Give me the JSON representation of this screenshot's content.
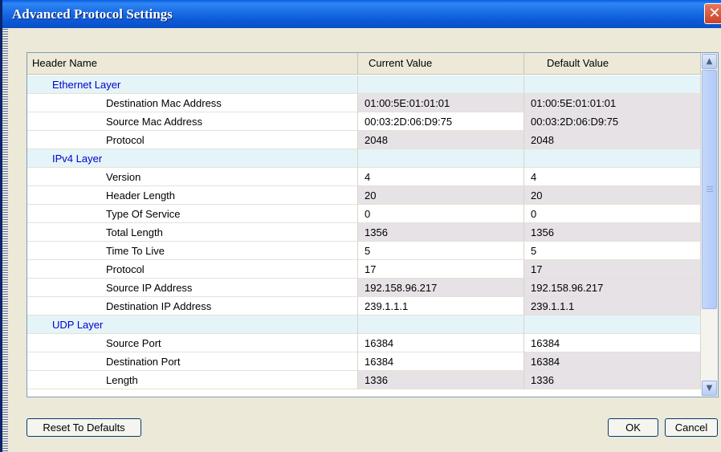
{
  "window": {
    "title": "Advanced Protocol Settings",
    "close_glyph": "✕"
  },
  "grid": {
    "columns": [
      "Header Name",
      "Current Value",
      "Default Value"
    ],
    "rows": [
      {
        "type": "group",
        "name": "Ethernet Layer"
      },
      {
        "type": "field",
        "name": "Destination Mac Address",
        "current": "01:00:5E:01:01:01",
        "default": "01:00:5E:01:01:01"
      },
      {
        "type": "field",
        "name": "Source Mac Address",
        "current": "00:03:2D:06:D9:75",
        "default": "00:03:2D:06:D9:75"
      },
      {
        "type": "field",
        "name": "Protocol",
        "current": "2048",
        "default": "2048"
      },
      {
        "type": "group",
        "name": "IPv4 Layer"
      },
      {
        "type": "field",
        "name": "Version",
        "current": "4",
        "default": "4"
      },
      {
        "type": "field",
        "name": "Header Length",
        "current": "20",
        "default": "20"
      },
      {
        "type": "field",
        "name": "Type Of Service",
        "current": "0",
        "default": "0"
      },
      {
        "type": "field",
        "name": "Total Length",
        "current": "1356",
        "default": "1356"
      },
      {
        "type": "field",
        "name": "Time To Live",
        "current": "5",
        "default": "5"
      },
      {
        "type": "field",
        "name": "Protocol",
        "current": "17",
        "default": "17"
      },
      {
        "type": "field",
        "name": "Source IP Address",
        "current": "192.158.96.217",
        "default": "192.158.96.217"
      },
      {
        "type": "field",
        "name": "Destination IP Address",
        "current": "239.1.1.1",
        "default": "239.1.1.1"
      },
      {
        "type": "group",
        "name": "UDP Layer"
      },
      {
        "type": "field",
        "name": "Source Port",
        "current": "16384",
        "default": "16384"
      },
      {
        "type": "field",
        "name": "Destination Port",
        "current": "16384",
        "default": "16384"
      },
      {
        "type": "field",
        "name": "Length",
        "current": "1336",
        "default": "1336"
      }
    ]
  },
  "buttons": {
    "reset": "Reset To Defaults",
    "ok": "OK",
    "cancel": "Cancel"
  },
  "colors": {
    "title_bar": "#0b59d6",
    "group_text": "#0000cc",
    "group_bg": "#e4f4f8"
  }
}
